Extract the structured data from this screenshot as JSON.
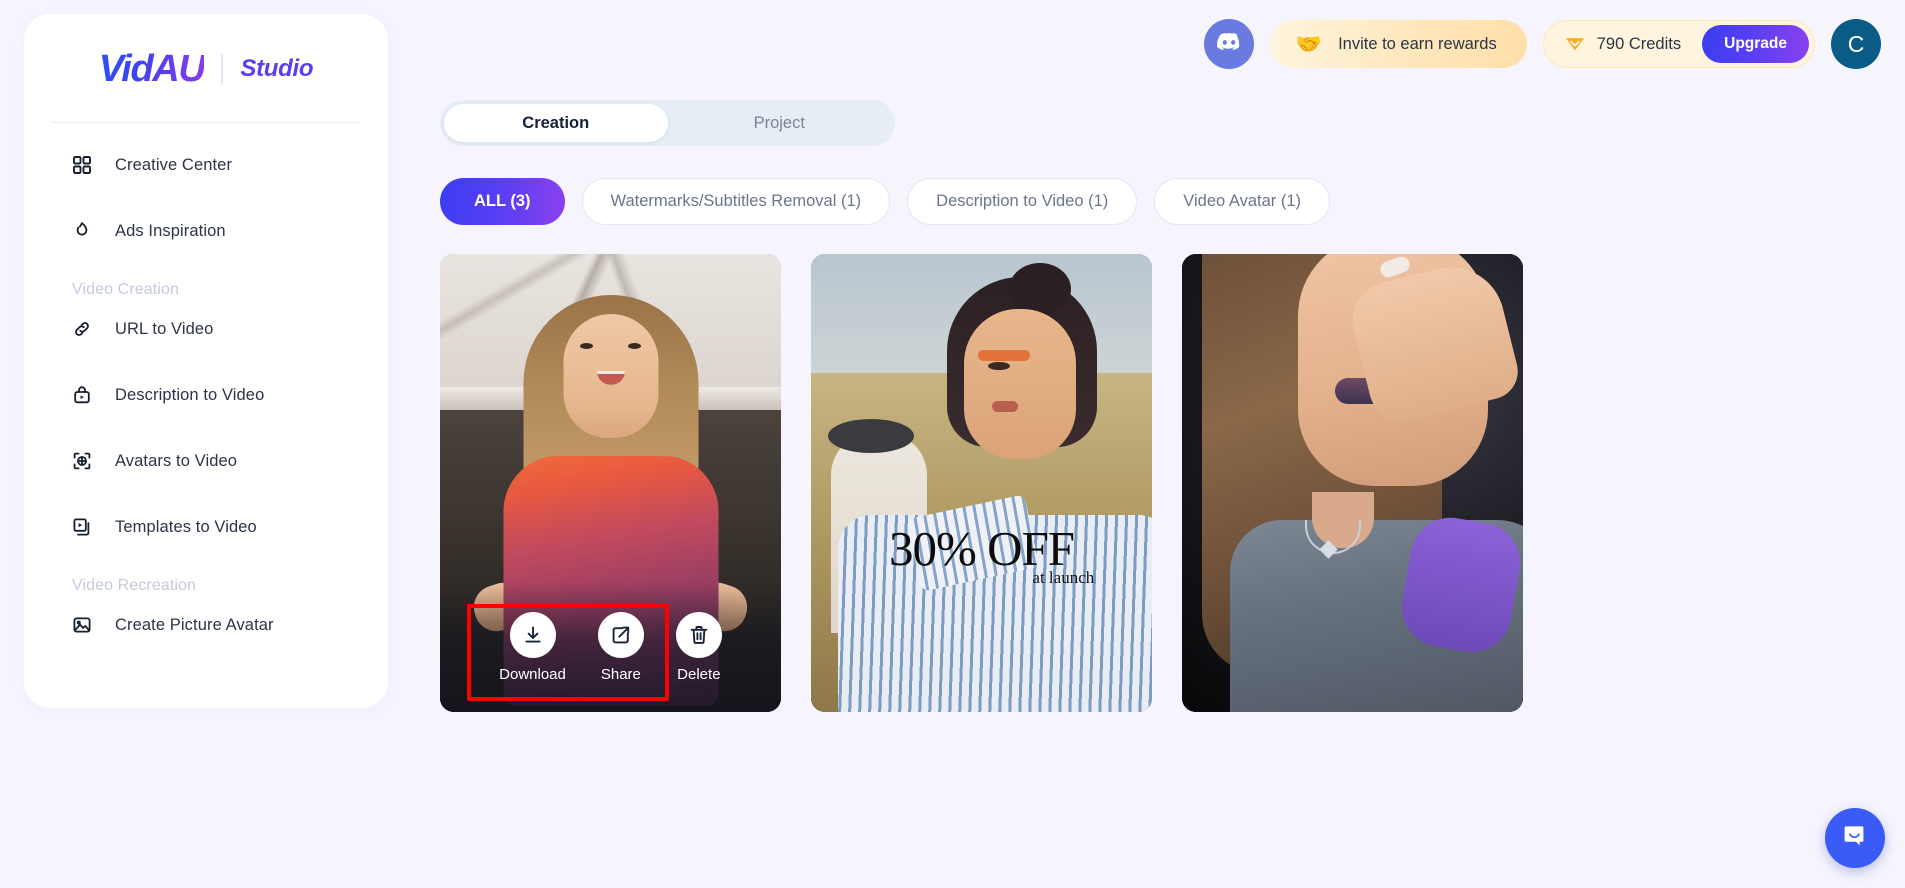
{
  "brand": {
    "logo": "VidAU",
    "product": "Studio"
  },
  "sidebar": {
    "items": [
      {
        "label": "Creative Center",
        "icon": "grid-icon"
      },
      {
        "label": "Ads Inspiration",
        "icon": "flame-icon"
      }
    ],
    "sections": [
      {
        "title": "Video Creation",
        "items": [
          {
            "label": "URL to Video",
            "icon": "link-icon"
          },
          {
            "label": "Description to Video",
            "icon": "video-bag-icon"
          },
          {
            "label": "Avatars to Video",
            "icon": "avatar-target-icon"
          },
          {
            "label": "Templates to Video",
            "icon": "templates-icon"
          }
        ]
      },
      {
        "title": "Video Recreation",
        "items": [
          {
            "label": "Create Picture Avatar",
            "icon": "image-icon"
          }
        ]
      }
    ]
  },
  "header": {
    "discord_icon": "discord-icon",
    "invite_emoji": "🤝",
    "invite_label": "Invite to earn rewards",
    "credits_label": "790 Credits",
    "credits_icon": "gem-icon",
    "upgrade_label": "Upgrade",
    "avatar_initial": "C"
  },
  "main": {
    "tabs": [
      {
        "label": "Creation",
        "active": true
      },
      {
        "label": "Project",
        "active": false
      }
    ],
    "filters": [
      {
        "label": "ALL (3)",
        "active": true
      },
      {
        "label": "Watermarks/Subtitles Removal (1)",
        "active": false
      },
      {
        "label": "Description to Video (1)",
        "active": false
      },
      {
        "label": "Video Avatar (1)",
        "active": false
      }
    ],
    "cards": [
      {
        "name": "kitchen-presenter-video",
        "actions": [
          {
            "label": "Download",
            "icon": "download-icon"
          },
          {
            "label": "Share",
            "icon": "share-icon"
          },
          {
            "label": "Delete",
            "icon": "trash-icon"
          }
        ]
      },
      {
        "name": "fashion-field-video",
        "overlay_headline": "30% OFF",
        "overlay_subline": "at launch"
      },
      {
        "name": "dark-portrait-video"
      }
    ]
  },
  "chat": {
    "icon": "chat-bubble-icon"
  },
  "colors": {
    "accent_start": "#3b3df2",
    "accent_end": "#8b40ee",
    "page_bg": "#f6f5fe",
    "credits_bg": "#fff4dd",
    "highlight": "#ff0000",
    "chat_bg": "#3b5bf6",
    "avatar_bg": "#0a5c86"
  }
}
